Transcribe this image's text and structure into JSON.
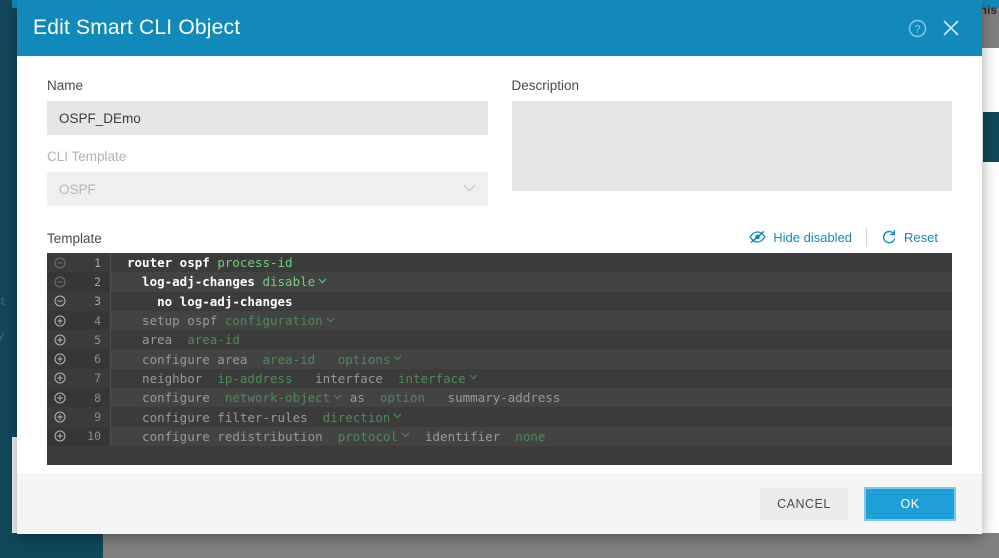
{
  "background": {
    "left_label_a": "ct",
    "left_label_b": "y",
    "right_label": "minis"
  },
  "modal": {
    "title": "Edit Smart CLI Object",
    "header": {
      "help_icon": "help-circle-icon",
      "help_glyph": "?",
      "close_icon": "close-icon"
    },
    "name_field": {
      "label": "Name",
      "value": "OSPF_DEmo",
      "placeholder": ""
    },
    "description_field": {
      "label": "Description",
      "value": "",
      "placeholder": ""
    },
    "cli_template_field": {
      "label": "CLI Template",
      "value": "OSPF",
      "disabled": true,
      "chevron_icon": "chevron-down-icon"
    },
    "template_section": {
      "label": "Template",
      "hide_disabled_label": "Hide disabled",
      "hide_disabled_icon": "eye-slash-icon",
      "reset_label": "Reset",
      "reset_icon": "refresh-icon"
    },
    "footer": {
      "cancel_label": "CANCEL",
      "ok_label": "OK"
    }
  },
  "code": {
    "lines": [
      {
        "number": "1",
        "fold": "minus",
        "fold_dim": true,
        "enabled": true,
        "tokens": [
          {
            "t": "router ospf ",
            "k": "kw"
          },
          {
            "t": "process-id",
            "k": "var"
          }
        ]
      },
      {
        "number": "2",
        "fold": "minus",
        "fold_dim": true,
        "enabled": true,
        "tokens": [
          {
            "t": "  log-adj-changes ",
            "k": "kw"
          },
          {
            "t": "disable",
            "k": "var",
            "chevron": true
          }
        ]
      },
      {
        "number": "3",
        "fold": "minus",
        "fold_dim": false,
        "enabled": true,
        "tokens": [
          {
            "t": "    no log-adj-changes",
            "k": "kw"
          }
        ]
      },
      {
        "number": "4",
        "fold": "plus",
        "fold_dim": false,
        "enabled": false,
        "tokens": [
          {
            "t": "  setup ospf ",
            "k": "kw-dim"
          },
          {
            "t": "configuration",
            "k": "var-dim",
            "chevron": true
          }
        ]
      },
      {
        "number": "5",
        "fold": "plus",
        "fold_dim": false,
        "enabled": false,
        "tokens": [
          {
            "t": "  area  ",
            "k": "kw-dim"
          },
          {
            "t": "area-id",
            "k": "var-dim"
          }
        ]
      },
      {
        "number": "6",
        "fold": "plus",
        "fold_dim": false,
        "enabled": false,
        "tokens": [
          {
            "t": "  configure area  ",
            "k": "kw-dim"
          },
          {
            "t": "area-id",
            "k": "var-dim"
          },
          {
            "t": "   ",
            "k": "kw-dim"
          },
          {
            "t": "options",
            "k": "var-dim",
            "chevron": true
          }
        ]
      },
      {
        "number": "7",
        "fold": "plus",
        "fold_dim": false,
        "enabled": false,
        "tokens": [
          {
            "t": "  neighbor  ",
            "k": "kw-dim"
          },
          {
            "t": "ip-address",
            "k": "var-dim"
          },
          {
            "t": "   interface  ",
            "k": "kw-dim"
          },
          {
            "t": "interface",
            "k": "var-dim",
            "chevron": true
          }
        ]
      },
      {
        "number": "8",
        "fold": "plus",
        "fold_dim": false,
        "enabled": false,
        "tokens": [
          {
            "t": "  configure  ",
            "k": "kw-dim"
          },
          {
            "t": "network-object",
            "k": "var-dim",
            "chevron": true
          },
          {
            "t": " as  ",
            "k": "kw-dim"
          },
          {
            "t": "option",
            "k": "var-dim"
          },
          {
            "t": "   summary-address",
            "k": "kw-dim"
          }
        ]
      },
      {
        "number": "9",
        "fold": "plus",
        "fold_dim": false,
        "enabled": false,
        "tokens": [
          {
            "t": "  configure filter-rules  ",
            "k": "kw-dim"
          },
          {
            "t": "direction",
            "k": "var-dim",
            "chevron": true
          }
        ]
      },
      {
        "number": "10",
        "fold": "plus",
        "fold_dim": false,
        "enabled": false,
        "tokens": [
          {
            "t": "  configure redistribution  ",
            "k": "kw-dim"
          },
          {
            "t": "protocol",
            "k": "var-dim",
            "chevron": true
          },
          {
            "t": "  identifier  ",
            "k": "kw-dim"
          },
          {
            "t": "none",
            "k": "var-dim"
          }
        ]
      }
    ]
  },
  "colors": {
    "brand_blue": "#1189bb",
    "accent_blue": "#1f9fd8",
    "sidebar_teal": "#12475a",
    "editor_bg": "#3b3b3b",
    "editor_alt": "#434343",
    "code_green": "#6fcf7f"
  }
}
